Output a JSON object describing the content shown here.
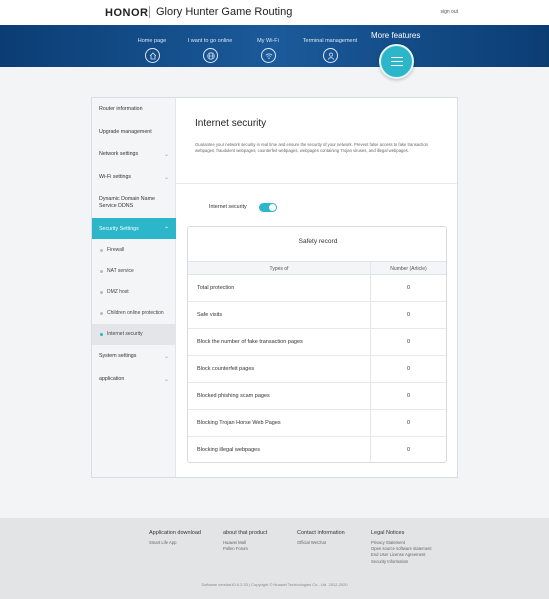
{
  "header": {
    "brand": "HONOR",
    "title": "Glory Hunter Game Routing",
    "sign_out": "sign out"
  },
  "nav": {
    "items": [
      {
        "label": "Home page",
        "icon": "home-icon"
      },
      {
        "label": "I want to go online",
        "icon": "globe-icon"
      },
      {
        "label": "My Wi-Fi",
        "icon": "wifi-icon"
      },
      {
        "label": "Terminal management",
        "icon": "user-icon"
      }
    ],
    "more_label": "More features",
    "more_icon": "menu-icon"
  },
  "sidebar": {
    "items": [
      {
        "label": "Router information"
      },
      {
        "label": "Upgrade management"
      },
      {
        "label": "Network settings",
        "chevron": "chevron-down-icon"
      },
      {
        "label": "Wi-Fi settings",
        "chevron": "chevron-down-icon"
      },
      {
        "label": "Dynamic Domain Name Service DDNS"
      },
      {
        "label": "Security Settings",
        "chevron": "chevron-up-icon",
        "active": true
      },
      {
        "label": "System settings",
        "chevron": "chevron-down-icon"
      },
      {
        "label": "application",
        "chevron": "chevron-down-icon"
      }
    ],
    "sub_items": [
      {
        "label": "Firewall"
      },
      {
        "label": "NAT service"
      },
      {
        "label": "DMZ host"
      },
      {
        "label": "Children online protection"
      },
      {
        "label": "Internet security",
        "active": true
      }
    ]
  },
  "main": {
    "title": "Internet security",
    "description": "Guarantee your network security in real time and ensure the security of your network. Prevent false access to fake transaction webpages, fraudulent webpages, counterfeit webpages, webpages containing Trojan viruses, and illegal webpages.",
    "toggle_label": "Internet security",
    "toggle_on": true,
    "record": {
      "title": "Safety record",
      "columns": [
        "Types of",
        "Number (Article)"
      ],
      "rows": [
        {
          "type": "Total protection",
          "count": "0"
        },
        {
          "type": "Safe visits",
          "count": "0"
        },
        {
          "type": "Block the number of fake transaction pages",
          "count": "0"
        },
        {
          "type": "Block counterfeit pages",
          "count": "0"
        },
        {
          "type": "Blocked phishing scam pages",
          "count": "0"
        },
        {
          "type": "Blocking Trojan Horse Web Pages",
          "count": "0"
        },
        {
          "type": "Blocking illegal webpages",
          "count": "0"
        }
      ]
    }
  },
  "footer": {
    "columns": [
      {
        "title": "Application download",
        "links": [
          "Smart Life App"
        ]
      },
      {
        "title": "about that product",
        "links": [
          "Huawei Mall",
          "Pollen Forum"
        ]
      },
      {
        "title": "Contact information",
        "links": [
          "Official WeChat"
        ]
      },
      {
        "title": "Legal Notices",
        "links": [
          "Privacy Statement",
          "Open source software statement",
          "End User License Agreement",
          "Security Information"
        ]
      }
    ],
    "copyright": "Software version10.0.2.33 | Copyright © Huawei Technologies Co., Ltd. 2012-2020"
  },
  "colors": {
    "accent": "#2bb7c9",
    "nav_bg": "#1b5a9b"
  }
}
